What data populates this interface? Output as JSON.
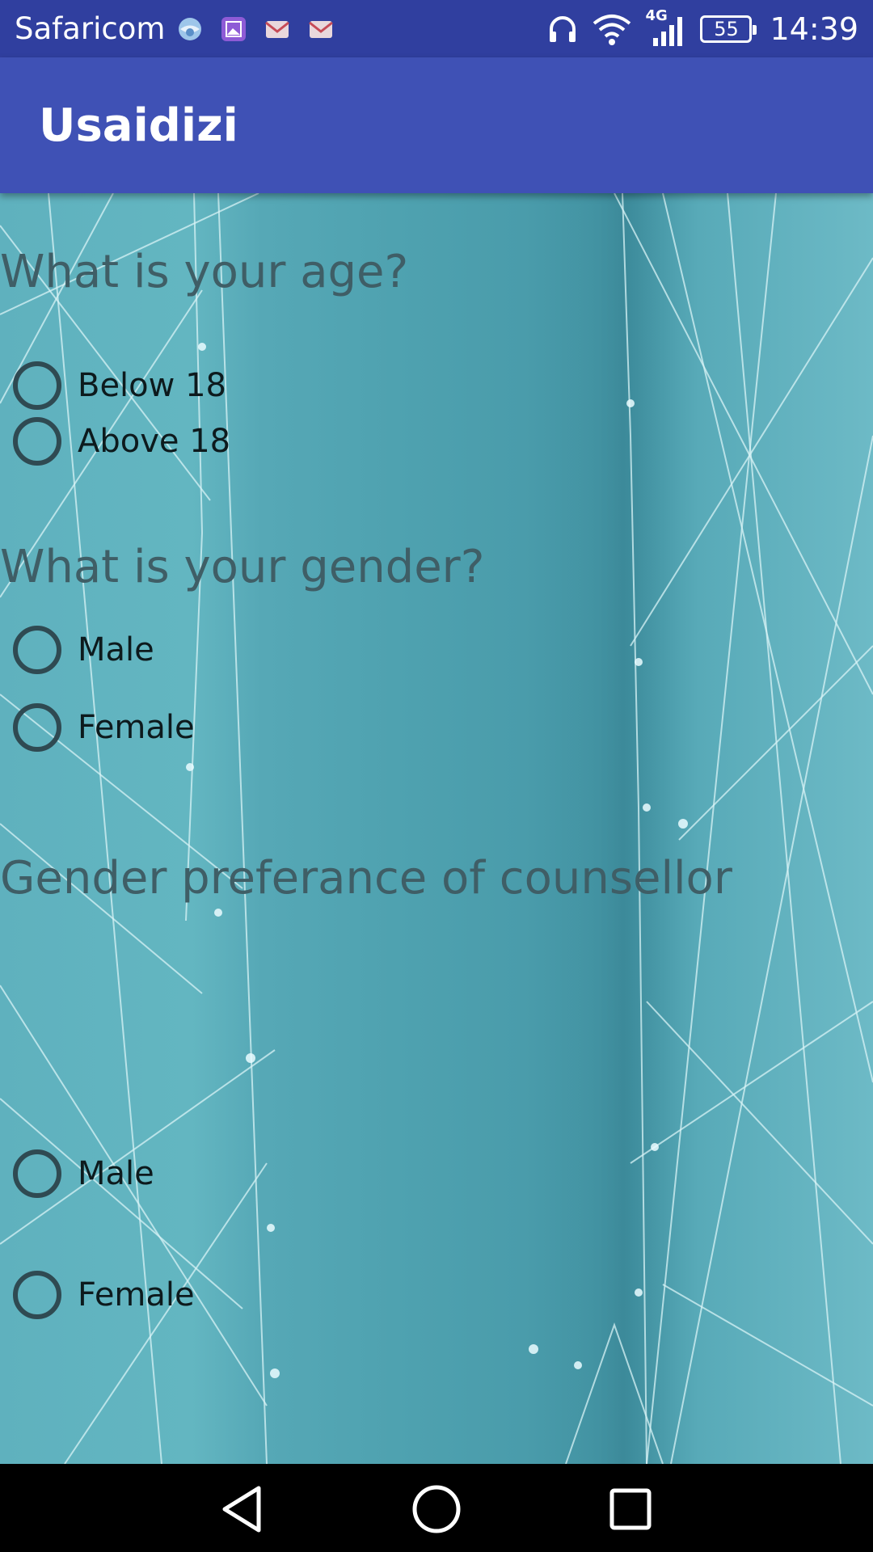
{
  "status_bar": {
    "carrier": "Safaricom",
    "network": "4G",
    "battery": "55",
    "time": "14:39",
    "bg_color": "#303f9f",
    "notification_icons": [
      "globe-icon",
      "gallery-icon",
      "gmail-icon",
      "gmail-icon"
    ]
  },
  "app_bar": {
    "title": "Usaidizi",
    "bg_color": "#3f51b5"
  },
  "questions": {
    "age": {
      "text": "What is your age?",
      "options": [
        "Below 18",
        "Above 18"
      ]
    },
    "gender": {
      "text": "What is your gender?",
      "options": [
        "Male",
        "Female"
      ]
    },
    "counsellor": {
      "text": "Gender preferance of counsellor",
      "options": [
        "Male",
        "Female"
      ]
    }
  },
  "nav_bar": {
    "buttons": [
      "back-icon",
      "home-icon",
      "recents-icon"
    ]
  }
}
